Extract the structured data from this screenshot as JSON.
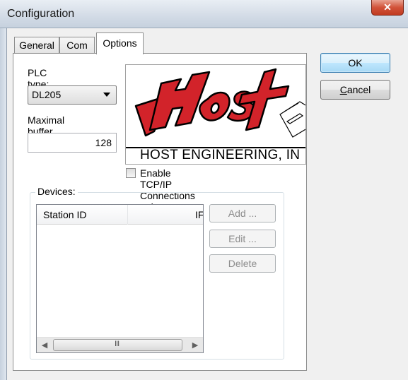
{
  "window": {
    "title": "Configuration",
    "close_glyph": "✕"
  },
  "tabs": [
    {
      "label": "General"
    },
    {
      "label": "Com"
    },
    {
      "label": "Options"
    }
  ],
  "options": {
    "plc_type_label": "PLC type:",
    "plc_type_value": "DL205",
    "buffer_label": "Maximal buffer size:",
    "buffer_value": "128",
    "logo_caption": "HOST ENGINEERING, IN",
    "tcp_checkbox_label": "Enable TCP/IP Connections only",
    "tcp_checked": false,
    "devices": {
      "group_label": "Devices:",
      "columns": [
        "Station ID",
        "IF"
      ],
      "rows": [],
      "add_label": "Add ...",
      "edit_label": "Edit ...",
      "delete_label": "Delete"
    }
  },
  "buttons": {
    "ok_label": "OK",
    "cancel_label": "Cancel"
  },
  "colors": {
    "logo_red": "#d2232a",
    "disabled_text": "#8d8d8d"
  }
}
